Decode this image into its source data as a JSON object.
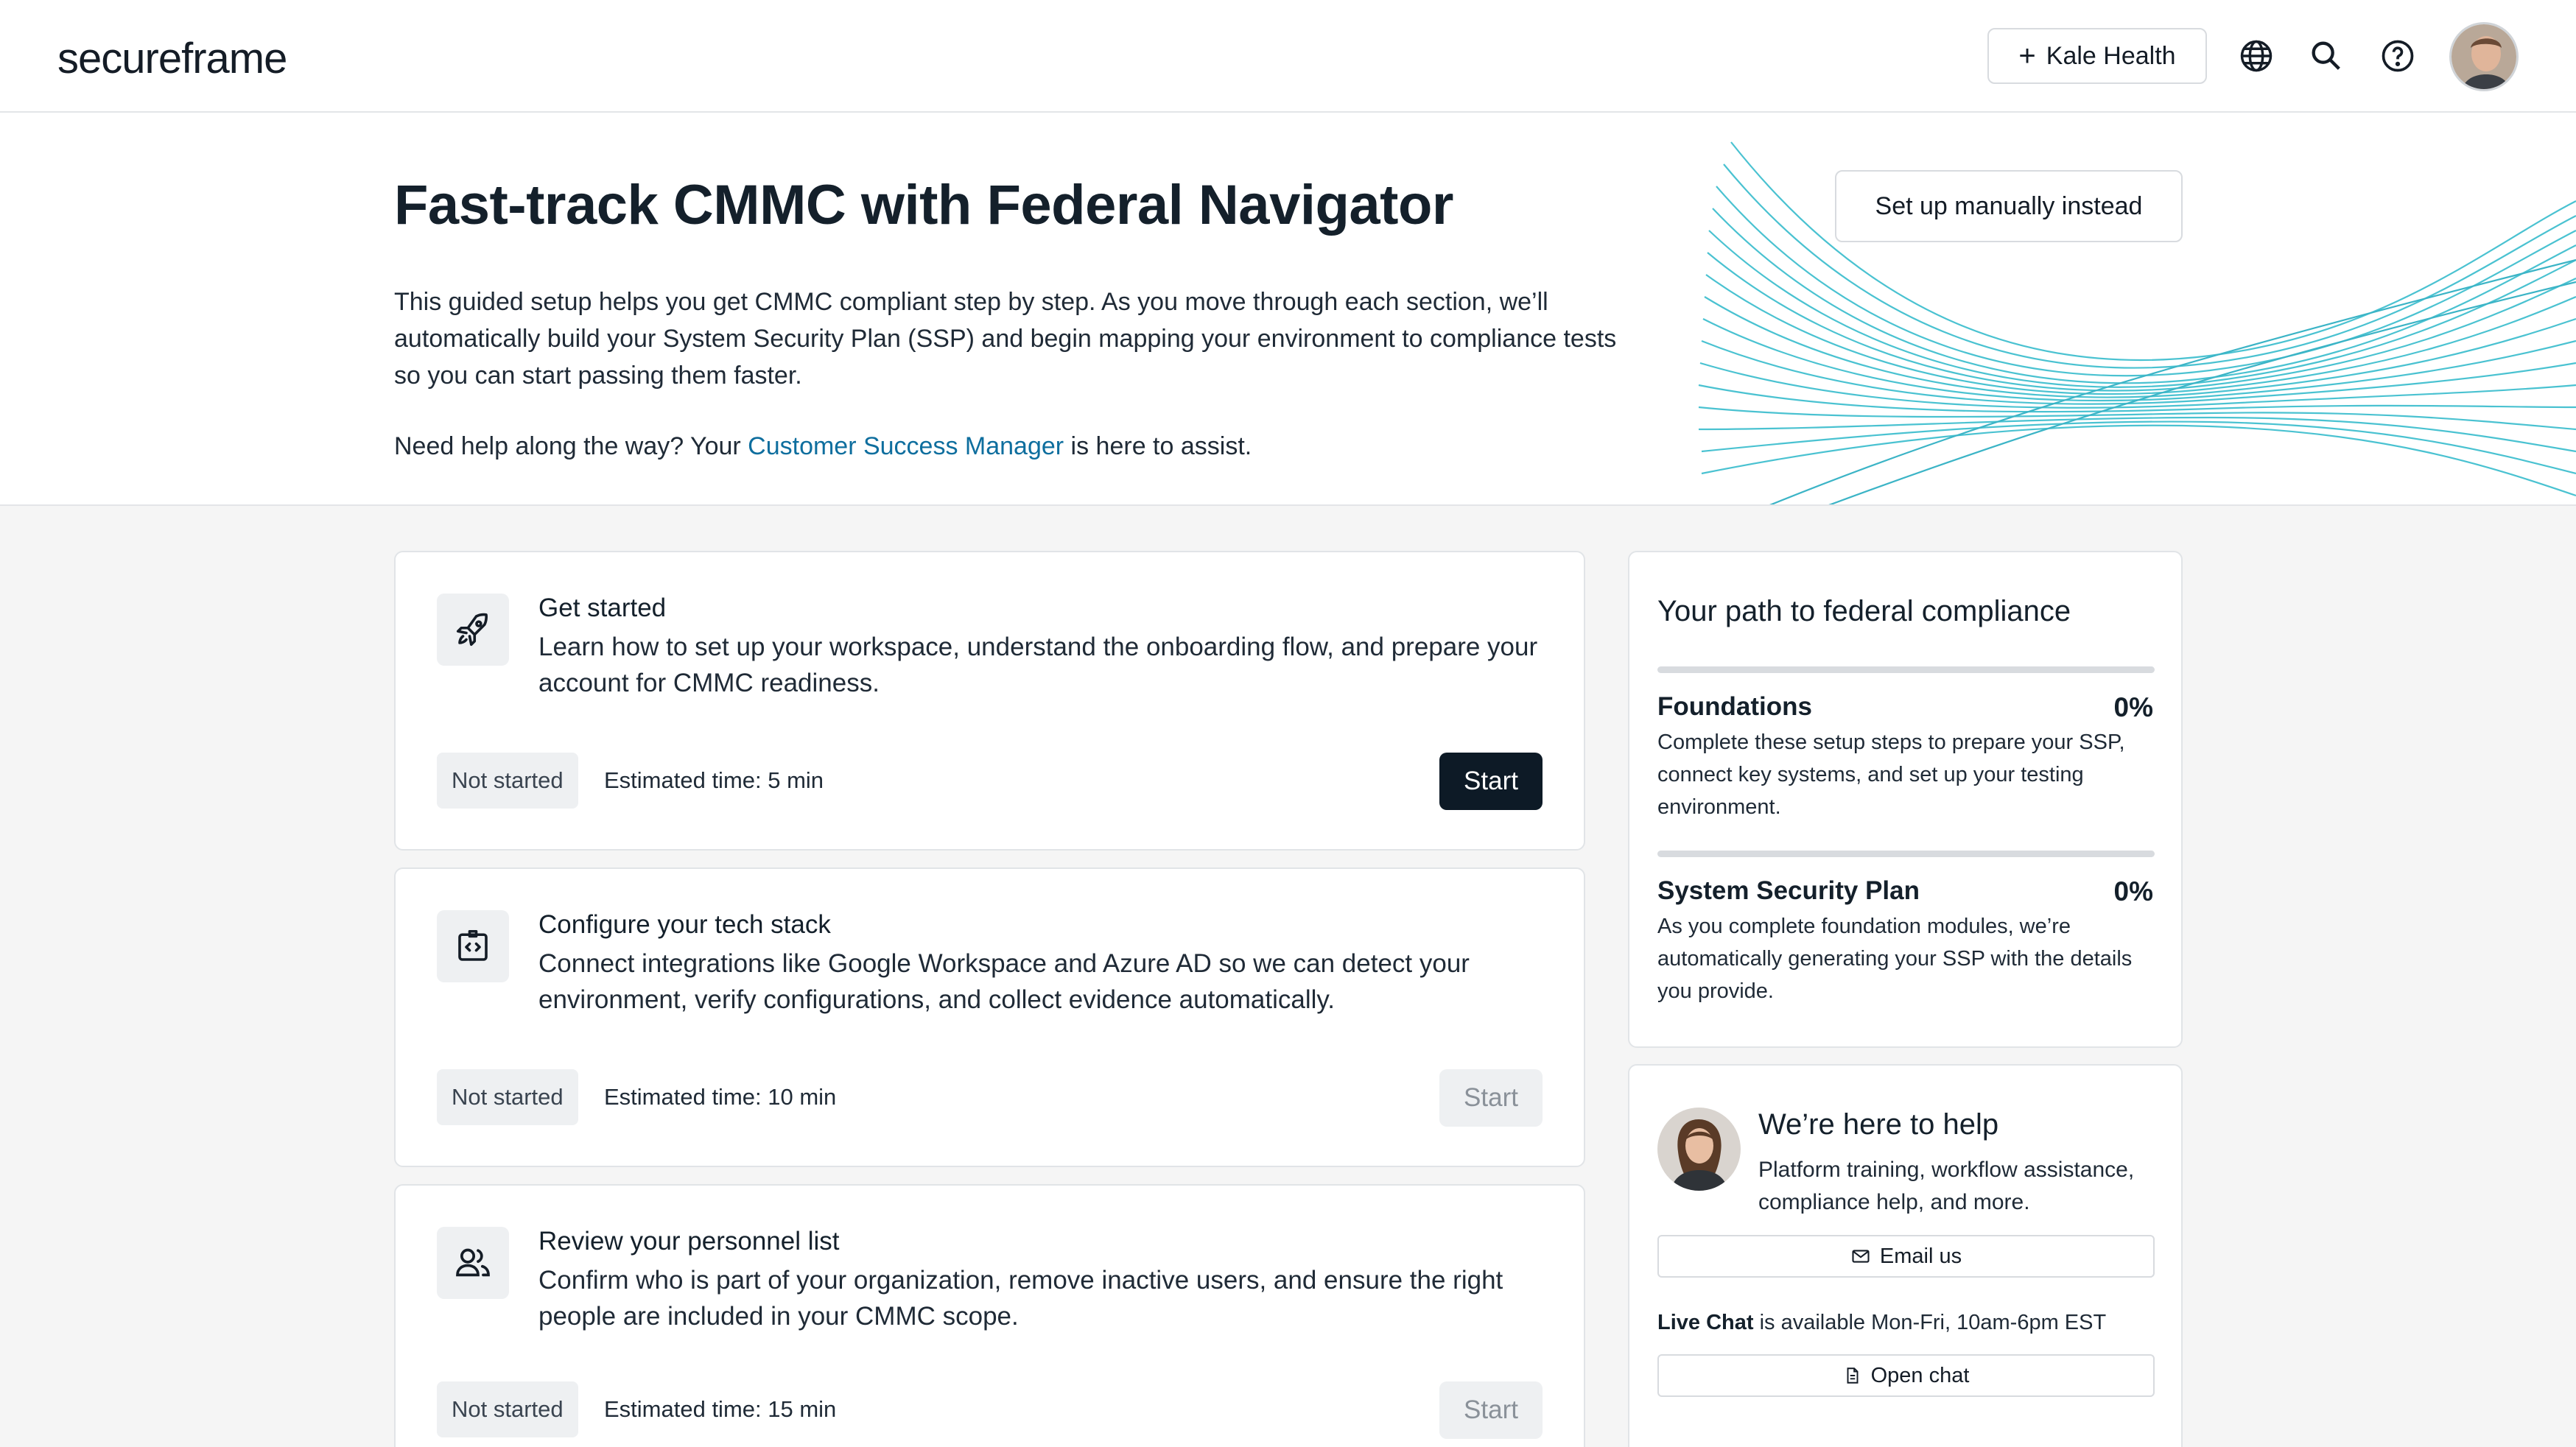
{
  "app": {
    "logo": "secureframe",
    "org_button": "Kale Health"
  },
  "hero": {
    "title": "Fast-track CMMC with Federal Navigator",
    "paragraph": "This guided setup helps you get CMMC compliant step by step. As you move through each section, we’ll automatically build your System Security Plan (SSP) and begin mapping your environment to compliance tests so you can start passing them faster.",
    "help_prefix": "Need help along the way? Your ",
    "help_link": "Customer Success Manager",
    "help_suffix": " is here to assist.",
    "manual_button": "Set up manually instead"
  },
  "tasks": [
    {
      "icon": "rocket-icon",
      "title": "Get started",
      "description": "Learn how to set up your workspace, understand the onboarding flow, and prepare your account for CMMC readiness.",
      "status": "Not started",
      "estimate": "Estimated time: 5 min",
      "button": "Start",
      "enabled": true
    },
    {
      "icon": "code-stack-icon",
      "title": "Configure your tech stack",
      "description": "Connect integrations like Google Workspace and Azure AD so we can detect your environment, verify configurations, and collect evidence automatically.",
      "status": "Not started",
      "estimate": "Estimated time: 10 min",
      "button": "Start",
      "enabled": false
    },
    {
      "icon": "people-icon",
      "title": "Review your personnel list",
      "description": "Confirm who is part of your organization, remove inactive users, and ensure the right people are included in your CMMC scope.",
      "status": "Not started",
      "estimate": "Estimated time: 15 min",
      "button": "Start",
      "enabled": false
    }
  ],
  "path_panel": {
    "title": "Your path to federal compliance",
    "items": [
      {
        "name": "Foundations",
        "percent": "0%",
        "progress": 0,
        "description": "Complete these setup steps to prepare your SSP, connect key systems, and set up your testing environment."
      },
      {
        "name": "System Security Plan",
        "percent": "0%",
        "progress": 0,
        "description": "As you complete foundation modules, we’re automatically generating your SSP with the details you provide."
      }
    ]
  },
  "help_panel": {
    "title": "We’re here to help",
    "description": "Platform training, workflow assistance, compliance help, and more.",
    "email_button": "Email us",
    "live_chat_label": "Live Chat",
    "live_chat_text": " is available Mon-Fri, 10am-6pm EST",
    "chat_button": "Open chat"
  },
  "colors": {
    "accent": "#0e6e9e",
    "primary_button": "#0d1a26",
    "wave": "#2bb8c9"
  }
}
